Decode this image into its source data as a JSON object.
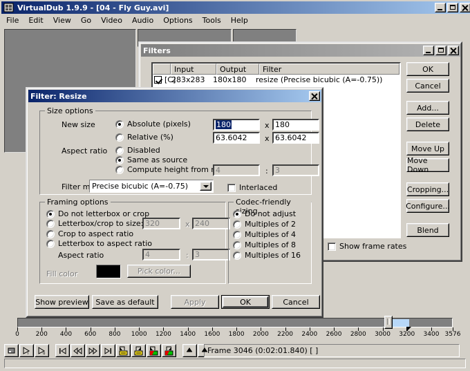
{
  "app": {
    "title": "VirtualDub 1.9.9 - [04 - Fly Guy.avi]",
    "menu": [
      "File",
      "Edit",
      "View",
      "Go",
      "Video",
      "Audio",
      "Options",
      "Tools",
      "Help"
    ],
    "window_buttons": {
      "minimize": "minimize-icon",
      "maximize": "maximize-icon",
      "close": "close-icon"
    }
  },
  "filters_dialog": {
    "title": "Filters",
    "columns": [
      "",
      "Input",
      "Output",
      "Filter"
    ],
    "rows": [
      {
        "enabled": true,
        "tag": "[C]",
        "input": "283x283",
        "output": "180x180",
        "filter": "resize (Precise bicubic (A=-0.75))"
      }
    ],
    "buttons": [
      "OK",
      "Cancel",
      "Add...",
      "Delete",
      "Move Up",
      "Move Down",
      "Cropping...",
      "Configure...",
      "Blend"
    ],
    "show_frame_rates": {
      "label": "Show frame rates",
      "checked": false
    }
  },
  "resize_dialog": {
    "title": "Filter: Resize",
    "size_options": {
      "legend": "Size options",
      "new_size_label": "New size",
      "absolute": {
        "label": "Absolute (pixels)",
        "selected": true,
        "width": "180",
        "height": "180",
        "width_selected": true
      },
      "relative": {
        "label": "Relative (%)",
        "selected": false,
        "width": "63.6042",
        "height": "63.6042"
      },
      "x_sep": "x",
      "aspect_ratio_label": "Aspect ratio",
      "aspect": [
        {
          "label": "Disabled",
          "selected": false
        },
        {
          "label": "Same as source",
          "selected": true
        },
        {
          "label": "Compute height from ratio:",
          "selected": false
        }
      ],
      "compute_ratio": {
        "num": "4",
        "den": "3",
        "sep": ":"
      },
      "filter_mode_label": "Filter mode",
      "filter_mode_value": "Precise bicubic (A=-0.75)",
      "interlaced": {
        "label": "Interlaced",
        "checked": false
      }
    },
    "framing": {
      "legend": "Framing options",
      "options": [
        {
          "label": "Do not letterbox or crop",
          "selected": true
        },
        {
          "label": "Letterbox/crop to size:",
          "selected": false
        },
        {
          "label": "Crop to aspect ratio",
          "selected": false
        },
        {
          "label": "Letterbox to aspect ratio",
          "selected": false
        }
      ],
      "letterbox_size": {
        "width": "320",
        "height": "240",
        "sep": "x"
      },
      "aspect_ratio_label": "Aspect ratio",
      "aspect_ratio": {
        "num": "4",
        "den": "3",
        "sep": ":"
      },
      "fill_color_label": "Fill color",
      "fill_color_value": "#000000",
      "pick_color_label": "Pick color..."
    },
    "codec": {
      "legend": "Codec-friendly sizing",
      "options": [
        {
          "label": "Do not adjust",
          "selected": true
        },
        {
          "label": "Multiples of 2",
          "selected": false
        },
        {
          "label": "Multiples of 4",
          "selected": false
        },
        {
          "label": "Multiples of 8",
          "selected": false
        },
        {
          "label": "Multiples of 16",
          "selected": false
        }
      ]
    },
    "buttons": {
      "show_preview": "Show preview",
      "save_as_default": "Save as default",
      "apply": "Apply",
      "apply_enabled": false,
      "ok": "OK",
      "cancel": "Cancel"
    }
  },
  "timeline": {
    "ticks": [
      0,
      200,
      400,
      600,
      800,
      1000,
      1200,
      1400,
      1600,
      1800,
      2000,
      2200,
      2400,
      2600,
      2800,
      3000,
      3200,
      3400,
      3576
    ],
    "min": 0,
    "max": 3576,
    "position": 3046,
    "selection_end": 3210
  },
  "transport": {
    "buttons": [
      "stop-icon",
      "output-playback-icon",
      "input-playback-icon",
      "start-icon",
      "rewind-icon",
      "fast-forward-icon",
      "end-icon",
      "prev-keyframe-icon",
      "next-keyframe-icon",
      "prev-scene-icon",
      "next-scene-icon",
      "mark-in-icon",
      "mark-out-icon"
    ]
  },
  "status": {
    "frame_text": "Frame 3046 (0:02:01.840) [ ]",
    "message": ""
  },
  "colors": {
    "face": "#d4d0c8",
    "title_active": "#0a246a",
    "title_inactive": "#808080",
    "video_pane": "#808080",
    "selection": "#b8d8f8",
    "highlight": "#0a246a"
  }
}
